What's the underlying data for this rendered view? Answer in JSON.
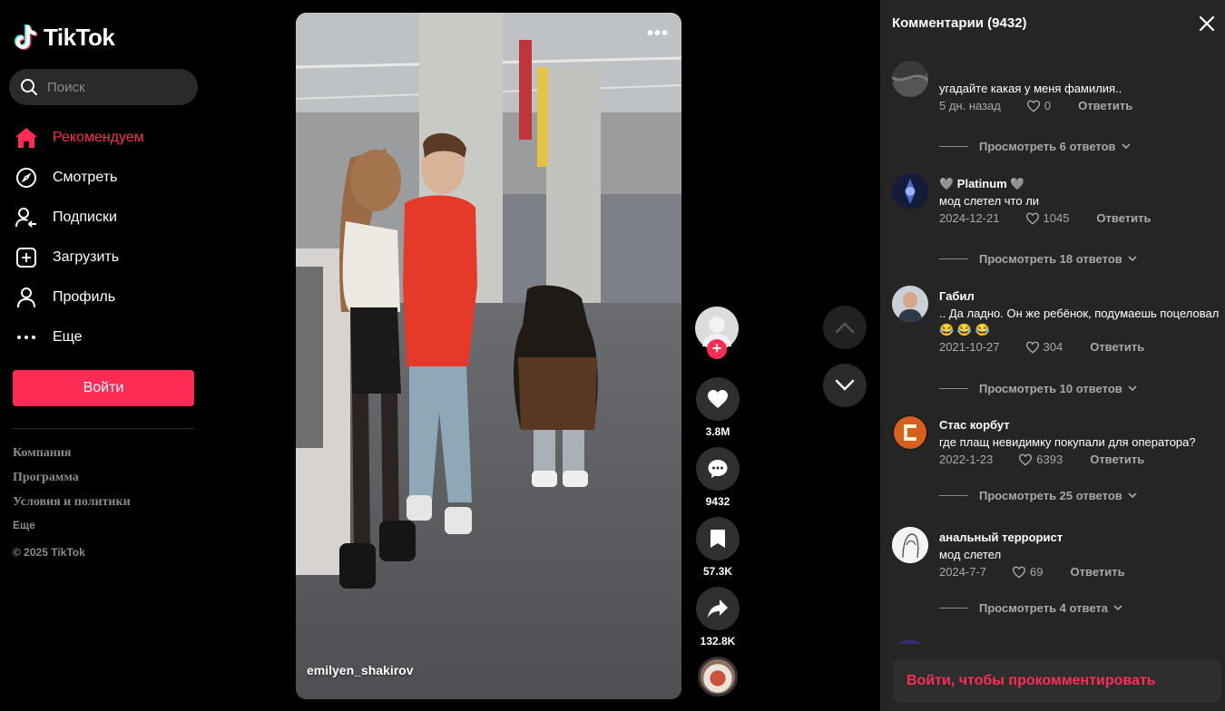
{
  "brand": {
    "name": "TikTok",
    "accent": "#fe2c55"
  },
  "search": {
    "placeholder": "Поиск"
  },
  "nav": [
    {
      "label": "Рекомендуем",
      "icon": "home-icon",
      "active": true
    },
    {
      "label": "Смотреть",
      "icon": "compass-icon"
    },
    {
      "label": "Подписки",
      "icon": "following-icon"
    },
    {
      "label": "Загрузить",
      "icon": "upload-icon"
    },
    {
      "label": "Профиль",
      "icon": "profile-icon"
    },
    {
      "label": "Еще",
      "icon": "more-icon"
    }
  ],
  "login_button": "Войти",
  "footer": {
    "links": [
      "Компания",
      "Программа",
      "Условия и политики"
    ],
    "more": "Еще",
    "copyright": "© 2025 TikTok"
  },
  "video": {
    "author": "emilyen_shakirov",
    "more_dots": "•••"
  },
  "actions": {
    "likes": "3.8M",
    "comments": "9432",
    "saves": "57.3K",
    "shares": "132.8K"
  },
  "comments_panel": {
    "title": "Комментарии (9432)",
    "items": [
      {
        "user": "",
        "text": "угадайте какая у меня фамилия..",
        "date": "5 дн. назад",
        "likes": "0",
        "reply": "Ответить",
        "replies": "Просмотреть 6 ответов"
      },
      {
        "user": "🩶 Platinum 🩶",
        "text": "мод слетел что ли",
        "date": "2024-12-21",
        "likes": "1045",
        "reply": "Ответить",
        "replies": "Просмотреть 18 ответов"
      },
      {
        "user": "Габил",
        "text": ".. Да ладно. Он же ребёнок, подумаешь поцеловал😂 😂 😂",
        "date": "2021-10-27",
        "likes": "304",
        "reply": "Ответить",
        "replies": "Просмотреть 10 ответов"
      },
      {
        "user": "Стас корбут",
        "text": "где плащ невидимку покупали для оператора?",
        "date": "2022-1-23",
        "likes": "6393",
        "reply": "Ответить",
        "replies": "Просмотреть 25 ответов"
      },
      {
        "user": "анальный террорист",
        "text": "мод слетел",
        "date": "2024-7-7",
        "likes": "69",
        "reply": "Ответить",
        "replies": "Просмотреть 4 ответа"
      }
    ],
    "login_prompt": "Войти, чтобы прокомментировать"
  }
}
